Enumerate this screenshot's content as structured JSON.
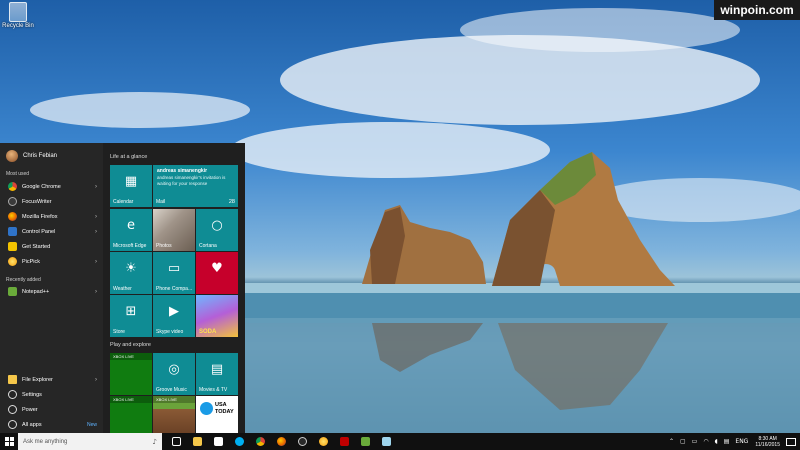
{
  "desktop": {
    "icon_label": "Recycle Bin",
    "watermark": "winpoin.com"
  },
  "start_menu": {
    "user_name": "Chris Febian",
    "most_used_label": "Most used",
    "most_used": [
      {
        "label": "Google Chrome",
        "icon": "chrome-icon",
        "has_arrow": true
      },
      {
        "label": "FocusWriter",
        "icon": "focuswriter-icon",
        "has_arrow": false
      },
      {
        "label": "Mozilla Firefox",
        "icon": "firefox-icon",
        "has_arrow": true
      },
      {
        "label": "Control Panel",
        "icon": "control-panel-icon",
        "has_arrow": true
      },
      {
        "label": "Get Started",
        "icon": "get-started-icon",
        "has_arrow": false
      },
      {
        "label": "PicPick",
        "icon": "picpick-icon",
        "has_arrow": true
      }
    ],
    "recently_added_label": "Recently added",
    "recently_added": [
      {
        "label": "Notepad++",
        "icon": "notepadpp-icon",
        "has_arrow": true
      }
    ],
    "bottom": {
      "file_explorer": "File Explorer",
      "settings": "Settings",
      "power": "Power",
      "all_apps": "All apps",
      "new_badge": "New"
    },
    "groups": {
      "life": "Life at a glance",
      "play": "Play and explore"
    },
    "tiles": {
      "calendar": "Calendar",
      "mail": {
        "label": "Mail",
        "count": "28",
        "sender": "andreas simanengkir",
        "message": "andreas simanengkir's invitation is waiting for your response"
      },
      "edge": "Microsoft Edge",
      "photos": "Photos",
      "cortana": "Cortana",
      "weather": "Weather",
      "phone": "Phone Compa...",
      "store": "Store",
      "skype": "Skype video",
      "groove": "Groove Music",
      "movies": "Movies & TV",
      "xbox_live": "XBOX LIVE",
      "usa_today": "USA TODAY",
      "candy_text": "SODA"
    }
  },
  "taskbar": {
    "search_placeholder": "Ask me anything",
    "language": "ENG",
    "time": "8:30 AM",
    "date": "11/16/2015"
  },
  "colors": {
    "tile_accent": "#0f8c94",
    "start_bg": "#1f1f1f",
    "taskbar_bg": "#101010"
  }
}
